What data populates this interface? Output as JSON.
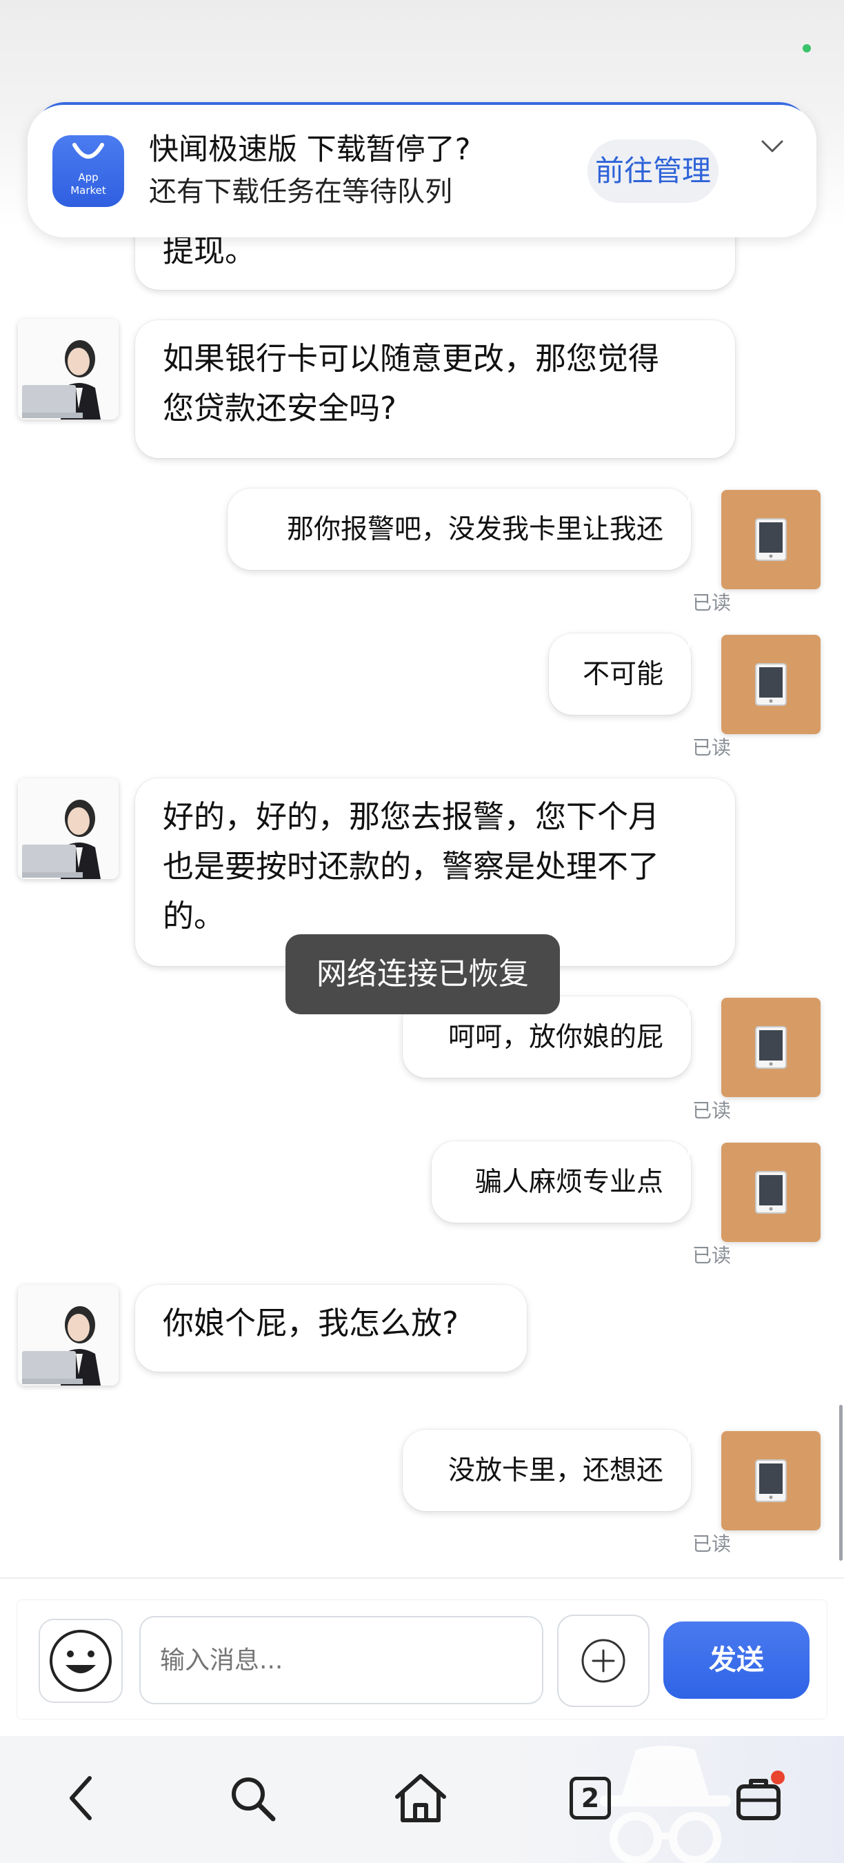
{
  "notification": {
    "app_icon_label_line1": "App",
    "app_icon_label_line2": "Market",
    "title": "快闻极速版 下载暂停了?",
    "subtitle": "还有下载任务在等待队列",
    "action_label": "前往管理"
  },
  "messages": [
    {
      "from": "agent",
      "lines": [
        "提现。"
      ],
      "partial": true
    },
    {
      "from": "agent",
      "lines": [
        "如果银行卡可以随意更改，那您觉得",
        "您贷款还安全吗?"
      ]
    },
    {
      "from": "user",
      "lines": [
        "那你报警吧，没发我卡里让我还"
      ],
      "status": "已读"
    },
    {
      "from": "user",
      "lines": [
        "不可能"
      ],
      "status": "已读"
    },
    {
      "from": "agent",
      "lines": [
        "好的，好的，那您去报警，您下个月",
        "也是要按时还款的，警察是处理不了",
        "的。"
      ]
    },
    {
      "from": "user",
      "lines": [
        "呵呵，放你娘的屁"
      ],
      "status": "已读"
    },
    {
      "from": "user",
      "lines": [
        "骗人麻烦专业点"
      ],
      "status": "已读"
    },
    {
      "from": "agent",
      "lines": [
        "你娘个屁，我怎么放?"
      ]
    },
    {
      "from": "user",
      "lines": [
        "没放卡里，还想还"
      ],
      "status": "已读"
    }
  ],
  "toast": "网络连接已恢复",
  "composer": {
    "placeholder": "输入消息...",
    "send_label": "发送"
  },
  "bottom_nav": {
    "tab_count": "2"
  },
  "colors": {
    "accent": "#2f64e6",
    "user_avatar_bg": "#d79c66",
    "banner_action_text": "#2f63d8"
  },
  "icons": [
    "app-market-icon",
    "chevron-down-icon",
    "tablet-icon",
    "agent-avatar",
    "emoji-icon",
    "plus-circle-icon",
    "back-icon",
    "search-icon",
    "home-icon",
    "tabs-icon",
    "briefcase-icon",
    "incognito-icon"
  ]
}
